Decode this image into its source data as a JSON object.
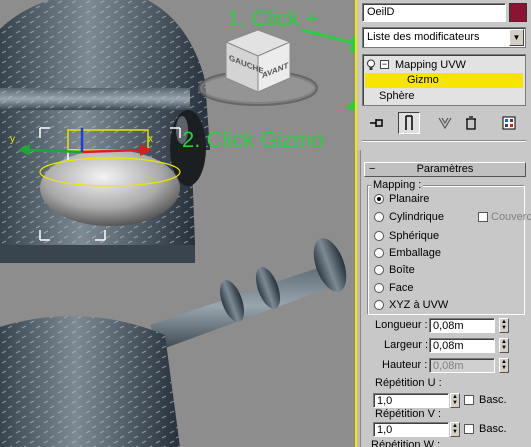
{
  "annotations": {
    "step1": "1. Click +",
    "step2": "2. Click Gizmo"
  },
  "viewcube": {
    "face_left": "GAUCHE",
    "face_front": "AVANT"
  },
  "panel": {
    "object_name": "OeilD",
    "object_color": "#8a1533",
    "modifier_list_label": "Liste des modificateurs",
    "stack": [
      {
        "label": "Mapping UVW",
        "expanded": true
      },
      {
        "label": "Gizmo",
        "selected": true
      },
      {
        "label": "Sphère"
      }
    ],
    "toolbar_icons": [
      "pin-stack-icon",
      "show-end-result-icon",
      "make-unique-icon",
      "remove-modifier-icon",
      "configure-sets-icon"
    ]
  },
  "parametres": {
    "title": "Paramètres",
    "mapping_group": "Mapping :",
    "options": [
      "Planaire",
      "Cylindrique",
      "Sphérique",
      "Emballage",
      "Boîte",
      "Face",
      "XYZ à UVW"
    ],
    "selected_option": "Planaire",
    "couvercle_label": "Couvercle",
    "longueur_label": "Longueur :",
    "longueur_value": "0,08m",
    "largeur_label": "Largeur :",
    "largeur_value": "0,08m",
    "hauteur_label": "Hauteur :",
    "hauteur_value": "0,08m",
    "repetition_u_label": "Répétition U :",
    "repetition_u_value": "1,0",
    "repetition_v_label": "Répétition V :",
    "repetition_v_value": "1,0",
    "repetition_w_label": "Répétition W :",
    "basc_label": "Basc."
  }
}
